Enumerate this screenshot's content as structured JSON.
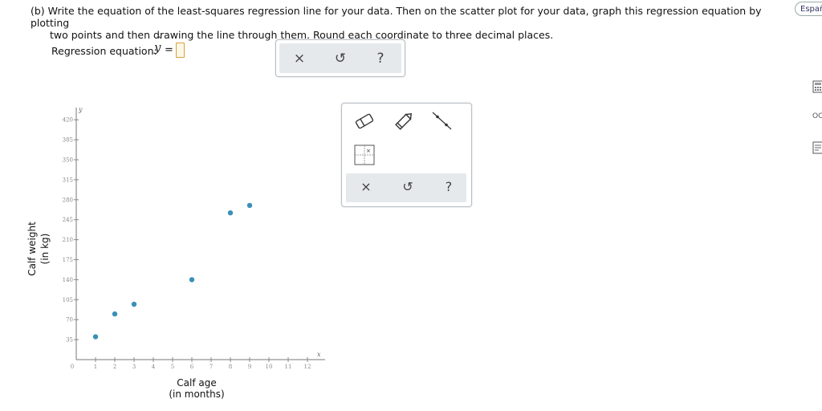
{
  "question": {
    "line1": "(b) Write the equation of the least-squares regression line for your data. Then on the scatter plot for your data, graph this regression equation by plotting",
    "line2": "two points and then drawing the line through them. Round each coordinate to three decimal places."
  },
  "language_button": "Españ",
  "regression": {
    "label": "Regression equation:",
    "yhat": "y",
    "hat": "^",
    "equals": "="
  },
  "equation_toolbar": {
    "clear": "×",
    "undo": "↺",
    "help": "?"
  },
  "graph_toolbar": {
    "tools": [
      "eraser-icon",
      "pencil-icon",
      "line-tool-icon",
      "grid-points-icon"
    ],
    "clear": "×",
    "undo": "↺",
    "help": "?"
  },
  "right_sidebar": {
    "text_fragment": "OC"
  },
  "chart_data": {
    "type": "scatter",
    "xlabel": [
      "Calf age",
      "(in months)"
    ],
    "ylabel": [
      "Calf weight",
      "(in kg)"
    ],
    "x_axis_symbol": "x",
    "y_axis_symbol": "y",
    "xlim": [
      0,
      13
    ],
    "ylim": [
      0,
      450
    ],
    "x_ticks": [
      0,
      1,
      2,
      3,
      4,
      5,
      6,
      7,
      8,
      9,
      10,
      11,
      12
    ],
    "y_ticks": [
      35,
      70,
      105,
      140,
      175,
      210,
      245,
      280,
      315,
      350,
      385,
      420
    ],
    "grid": false,
    "point_color": "#3a8fb7",
    "points": [
      {
        "x": 1,
        "y": 40
      },
      {
        "x": 2,
        "y": 80
      },
      {
        "x": 3,
        "y": 97
      },
      {
        "x": 6,
        "y": 140
      },
      {
        "x": 8,
        "y": 257
      },
      {
        "x": 9,
        "y": 270
      }
    ]
  }
}
